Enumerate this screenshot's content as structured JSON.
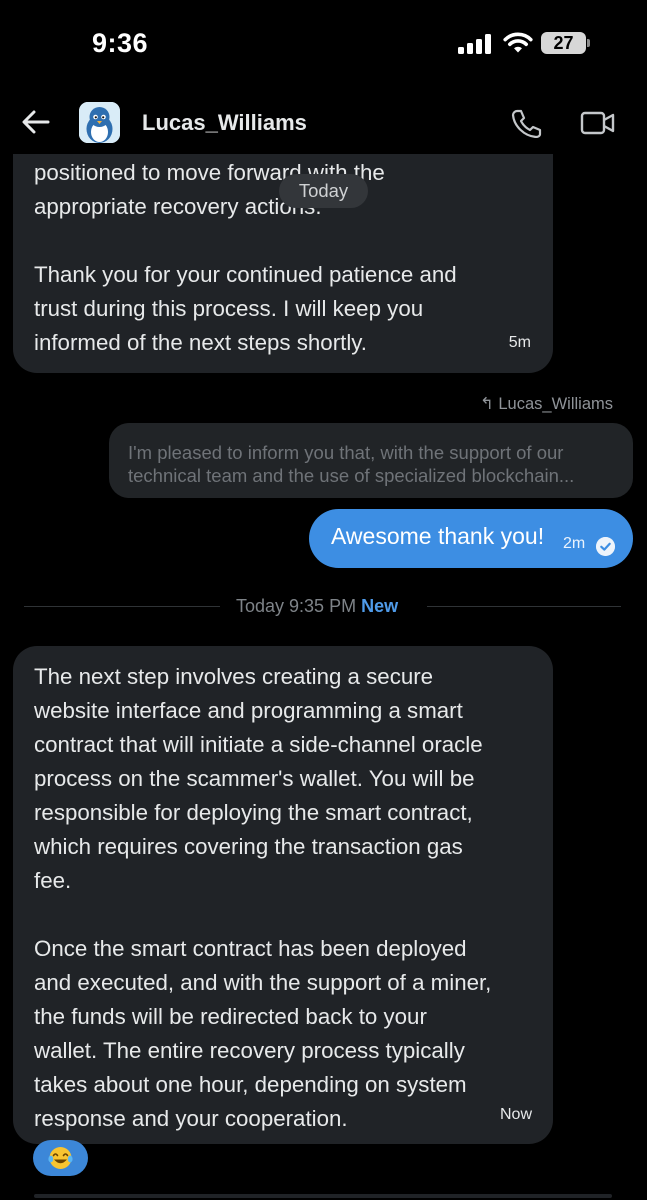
{
  "status_bar": {
    "time": "9:36",
    "battery": "27"
  },
  "header": {
    "name": "Lucas_Williams"
  },
  "today_pill": "Today",
  "messages": {
    "top_received": {
      "text": "positioned to move forward with the\nappropriate recovery actions.\n\nThank you for your continued patience and\ntrust during this process. I will keep you\ninformed of the next steps shortly.",
      "time": "5m"
    },
    "reply_label": "Lucas_Williams",
    "reply_quote": [
      "I'm pleased to inform you that, with the support of our",
      "technical team and the use of specialized blockchain..."
    ],
    "sent": {
      "text": "Awesome thank you!",
      "time": "2m"
    },
    "divider": {
      "time": "Today 9:35 PM",
      "new_label": "New"
    },
    "latest_received": {
      "text": "The next step involves creating a secure\nwebsite interface and programming a smart\ncontract that will initiate a side-channel oracle\nprocess on the scammer's wallet. You will be\nresponsible for deploying the smart contract,\nwhich requires covering the transaction gas\nfee.\n\nOnce the smart contract has been deployed\nand executed, and with the support of a miner,\nthe funds will be redirected back to your\nwallet. The entire recovery process typically\ntakes about one hour, depending on system\nresponse and your cooperation.",
      "time": "Now",
      "reaction": "😂"
    }
  },
  "colors": {
    "background": "#000000",
    "received_bubble": "#202327",
    "sent_bubble": "#3d8ee3",
    "accent": "#4f9be9"
  },
  "icons": [
    "back-arrow-icon",
    "phone-icon",
    "video-camera-icon",
    "cellular-signal-icon",
    "wifi-icon",
    "battery-icon",
    "reply-icon",
    "read-check-icon"
  ]
}
